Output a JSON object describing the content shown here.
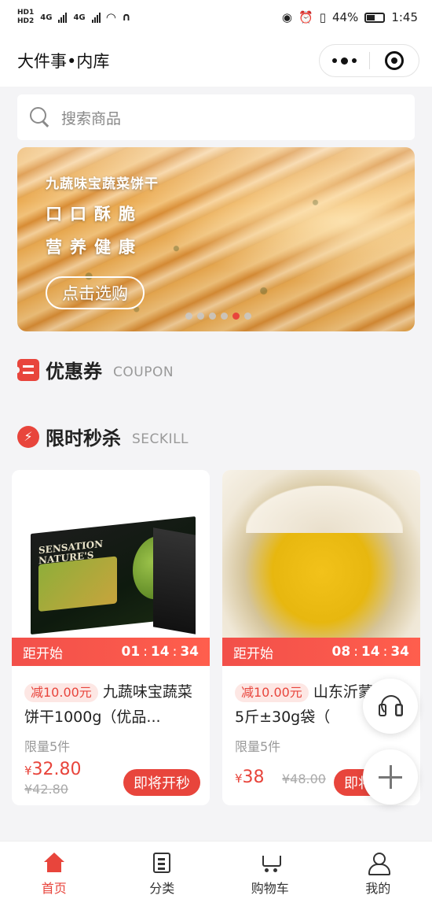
{
  "status_bar": {
    "hd1": "HD1",
    "hd2": "HD2",
    "net1": "4G",
    "net2": "4G",
    "battery": "44%",
    "time": "1:45"
  },
  "header": {
    "title": "大件事•内库"
  },
  "search": {
    "placeholder": "搜索商品"
  },
  "banner": {
    "title": "九蔬味宝蔬菜饼干",
    "line1": "口口酥脆",
    "line2": "营养健康",
    "button": "点击选购",
    "slide_count": 6,
    "active_slide": 5
  },
  "sections": {
    "coupon": {
      "title": "优惠券",
      "subtitle": "COUPON"
    },
    "seckill": {
      "title": "限时秒杀",
      "subtitle": "SECKILL"
    }
  },
  "products": [
    {
      "countdown_label": "距开始",
      "hours": "01",
      "minutes": "14",
      "seconds": "34",
      "discount": "减10.00元",
      "name": "九蔬味宝蔬菜饼干1000g（优品...",
      "limit": "限量5件",
      "currency": "¥",
      "price": "32.80",
      "original_price": "¥42.80",
      "button": "即将开秒",
      "box_brand_line1": "SENSATION",
      "box_brand_line2": "NATURE'S"
    },
    {
      "countdown_label": "距开始",
      "hours": "08",
      "minutes": "14",
      "seconds": "34",
      "discount": "减10.00元",
      "name": "山东沂蒙小米 5斤±30g袋（",
      "limit": "限量5件",
      "currency": "¥",
      "price": "38",
      "original_price": "¥48.00",
      "button": "即将开秒"
    }
  ],
  "tabs": [
    {
      "label": "首页",
      "icon": "home-icon",
      "active": true
    },
    {
      "label": "分类",
      "icon": "category-icon",
      "active": false
    },
    {
      "label": "购物车",
      "icon": "cart-icon",
      "active": false
    },
    {
      "label": "我的",
      "icon": "user-icon",
      "active": false
    }
  ],
  "colors": {
    "accent": "#e8453c",
    "background": "#f4f4f6"
  }
}
